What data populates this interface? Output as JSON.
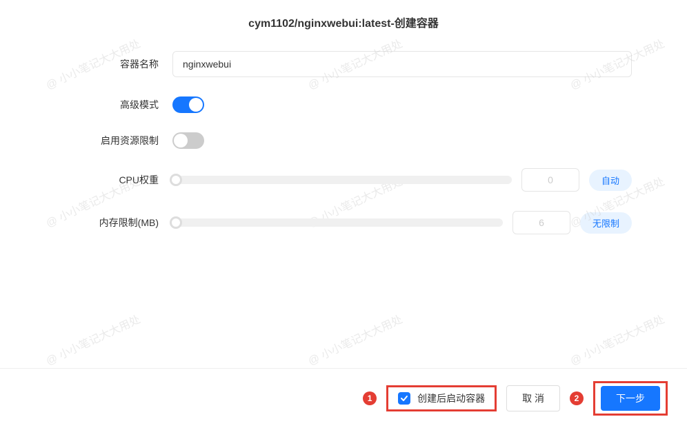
{
  "header": {
    "title": "cym1102/nginxwebui:latest-创建容器"
  },
  "form": {
    "container_name": {
      "label": "容器名称",
      "value": "nginxwebui"
    },
    "advanced_mode": {
      "label": "高级模式",
      "enabled": true
    },
    "resource_limit": {
      "label": "启用资源限制",
      "enabled": false
    },
    "cpu_weight": {
      "label": "CPU权重",
      "value": "0",
      "badge": "自动"
    },
    "memory_limit": {
      "label": "内存限制(MB)",
      "value": "6",
      "badge": "无限制"
    }
  },
  "footer": {
    "annotation_1": "1",
    "annotation_2": "2",
    "start_after_create": {
      "label": "创建后启动容器",
      "checked": true
    },
    "cancel_label": "取 消",
    "next_label": "下一步"
  },
  "watermark_text": "@ 小小笔记大大用处"
}
